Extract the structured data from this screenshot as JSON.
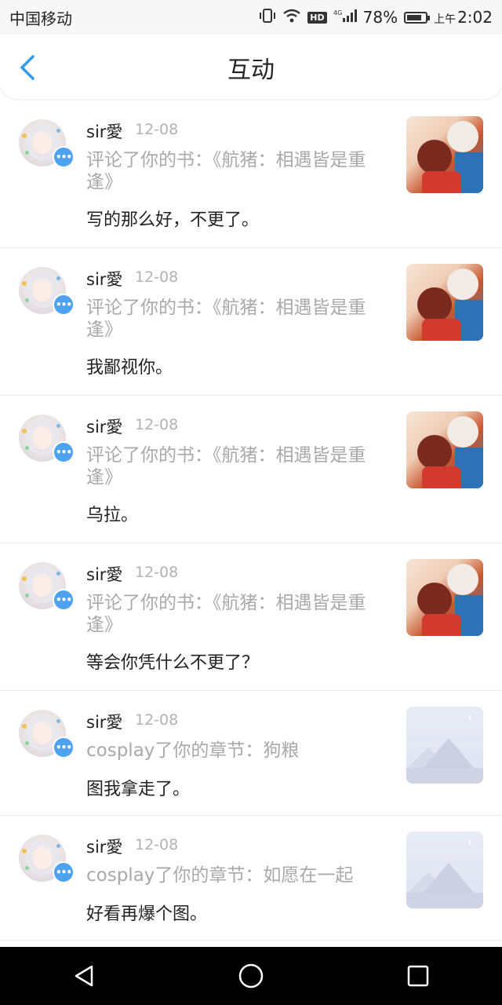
{
  "status_bar": {
    "carrier": "中国移动",
    "network": "4G",
    "hd": "HD",
    "battery": "78%",
    "time_prefix": "上午",
    "time": "2:02"
  },
  "header": {
    "title": "互动"
  },
  "notifications": [
    {
      "user": "sir愛",
      "date": "12-08",
      "action": "评论了你的书：《航猪：相遇皆是重逢》",
      "content": "写的那么好，不更了。",
      "thumb": "book-cover"
    },
    {
      "user": "sir愛",
      "date": "12-08",
      "action": "评论了你的书：《航猪：相遇皆是重逢》",
      "content": "我鄙视你。",
      "thumb": "book-cover"
    },
    {
      "user": "sir愛",
      "date": "12-08",
      "action": "评论了你的书：《航猪：相遇皆是重逢》",
      "content": "乌拉。",
      "thumb": "book-cover"
    },
    {
      "user": "sir愛",
      "date": "12-08",
      "action": "评论了你的书：《航猪：相遇皆是重逢》",
      "content": "等会你凭什么不更了？",
      "thumb": "book-cover"
    },
    {
      "user": "sir愛",
      "date": "12-08",
      "action": "cosplay了你的章节：狗粮",
      "content": "图我拿走了。",
      "thumb": "placeholder-image"
    },
    {
      "user": "sir愛",
      "date": "12-08",
      "action": "cosplay了你的章节：如愿在一起",
      "content": "好看再爆个图。",
      "thumb": "placeholder-image"
    }
  ],
  "colors": {
    "accent": "#2e9af0",
    "badge": "#4da3f0",
    "secondary_text": "#a9a9a9"
  }
}
